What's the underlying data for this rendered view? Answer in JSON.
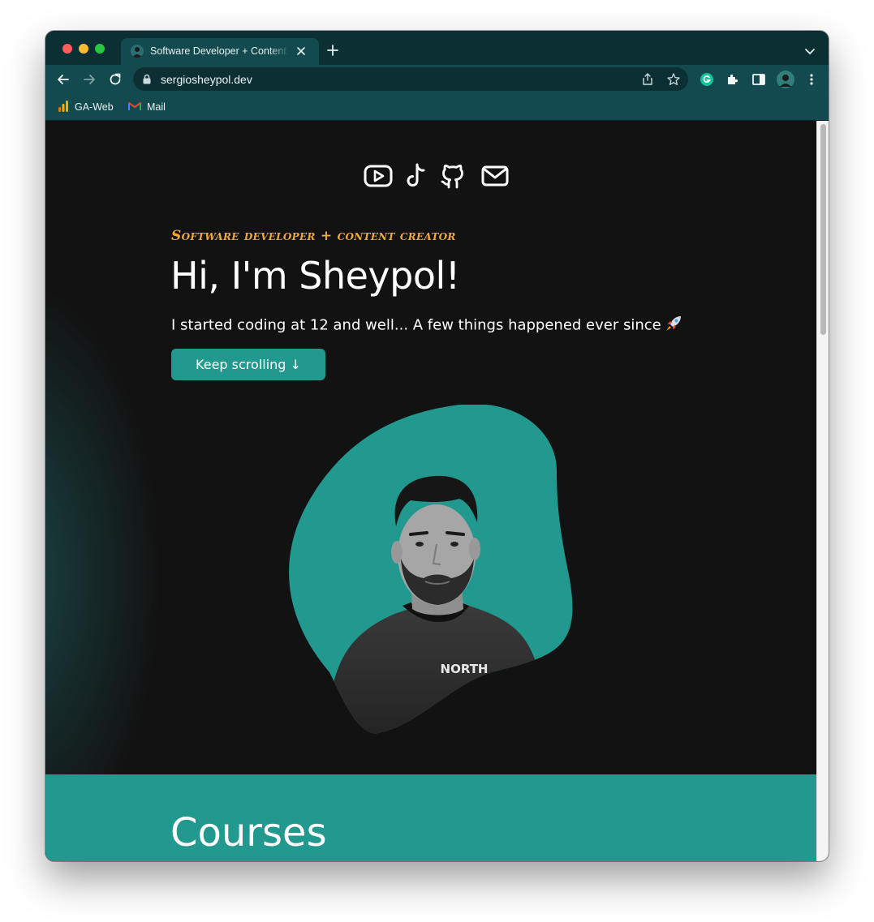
{
  "browser": {
    "tab_title": "Software Developer + Content Creator",
    "url": "sergiosheypol.dev",
    "bookmarks": [
      {
        "label": "GA-Web",
        "icon": "analytics-icon"
      },
      {
        "label": "Mail",
        "icon": "gmail-icon"
      }
    ]
  },
  "hero": {
    "social_icons": [
      "youtube-icon",
      "tiktok-icon",
      "github-icon",
      "mail-icon"
    ],
    "eyebrow": "Software developer + content creator",
    "title": "Hi, I'm Sheypol!",
    "subtitle": "I started coding at 12 and well... A few things happened ever since",
    "cta_label": "Keep scrolling ↓",
    "shirt_text": "NORTH"
  },
  "courses": {
    "title": "Courses"
  },
  "colors": {
    "chrome_dark": "#0b2f33",
    "chrome": "#134a4f",
    "page_bg": "#121212",
    "accent": "#21998e",
    "eyebrow": "#f2a93b"
  }
}
